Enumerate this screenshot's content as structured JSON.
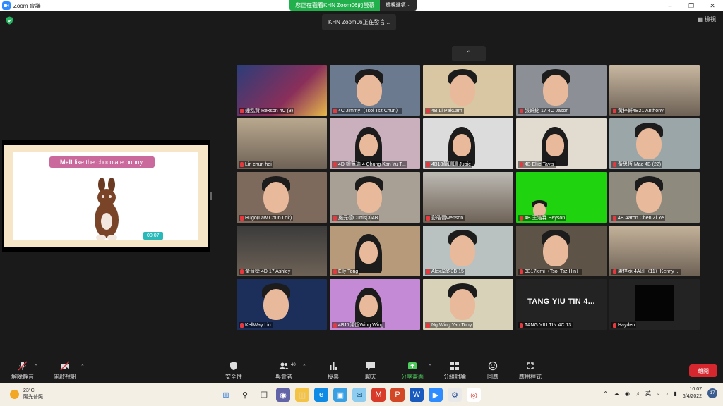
{
  "window": {
    "title": "Zoom 會議"
  },
  "share_banner": {
    "status": "您正在觀看KHN Zoom06的螢幕",
    "view_options": "檢視選項 ⌄"
  },
  "speaker_view": "檢視",
  "speaking_indicator": "KHN Zoom06正在發言...",
  "shared_slide": {
    "caption_bold": "Melt",
    "caption_rest": " like the chocolate bunny.",
    "timer": "00:07"
  },
  "participants": [
    {
      "name": "鍾泓賢 Rexson 4C (3)",
      "bg": "#2a3d7a",
      "kind": "anime"
    },
    {
      "name": "4C Jimmy（Tsoi Tsz Chun）",
      "bg": "#6b7a8e",
      "kind": "boy"
    },
    {
      "name": "4B Li PakLam",
      "bg": "#d9c6a3",
      "kind": "boy"
    },
    {
      "name": "張軒銘 17 4C Jason",
      "bg": "#8c8f96",
      "kind": "boy"
    },
    {
      "name": "黃梓軒4B21 Anthony",
      "bg": "#c9b8a1",
      "kind": "room"
    },
    {
      "name": "Lin chun hei",
      "bg": "#b9a88f",
      "kind": "room"
    },
    {
      "name": "4D 鍾蓮瑜 4 Chung Kan Yu T...",
      "bg": "#c9b0bc",
      "kind": "girl"
    },
    {
      "name": "4B18黃珊珊 Jubie",
      "bg": "#dcdcdc",
      "kind": "girl"
    },
    {
      "name": "4B Ellie Tavis",
      "bg": "#e2dcd0",
      "kind": "girl"
    },
    {
      "name": "黃思恆 Mac 4B (22)",
      "bg": "#9aa6a8",
      "kind": "boy"
    },
    {
      "name": "Hugo(Law Chun Lok)",
      "bg": "#7d6a5c",
      "kind": "boy"
    },
    {
      "name": "施元德Curtis(3)4B",
      "bg": "#a8a094",
      "kind": "boy"
    },
    {
      "name": "彭皓晉wenson",
      "bg": "#bdbab4",
      "kind": "room"
    },
    {
      "name": "4B 王浩霖 Heyson",
      "bg": "#1fd30f",
      "kind": "green"
    },
    {
      "name": "4B Aaron Chen Zi Ye",
      "bg": "#8e8a7e",
      "kind": "boy"
    },
    {
      "name": "黃晉婕 4D 17 Ashley",
      "bg": "#3b3b3b",
      "kind": "room"
    },
    {
      "name": "Elly Tong",
      "bg": "#b69a7a",
      "kind": "girl"
    },
    {
      "name": "Alex莫鈞3B 15",
      "bg": "#b9c2c1",
      "kind": "boy"
    },
    {
      "name": "3B17kimi（Tsoi Tsz Hin）",
      "bg": "#5e5347",
      "kind": "boy"
    },
    {
      "name": "盧梓丞 4A班（11）Kenny ...",
      "bg": "#c4b29a",
      "kind": "room"
    },
    {
      "name": "KellWay Lin",
      "bg": "#1b2f5a",
      "kind": "boy"
    },
    {
      "name": "4B17潘恆Wing Wing",
      "bg": "#c48ad6",
      "kind": "girl"
    },
    {
      "name": "Ng Wing Yan Toby",
      "bg": "#d8d2b8",
      "kind": "boy"
    },
    {
      "name": "TANG YIU TIN 4C 13",
      "bg": "#232323",
      "kind": "text",
      "display": "TANG YIU TIN 4..."
    },
    {
      "name": "Hayden",
      "bg": "#232323",
      "kind": "dark"
    }
  ],
  "toolbar": {
    "unmute": "解除靜音",
    "start_video": "開啟視訊",
    "security": "安全性",
    "participants": "與會者",
    "participants_count": "40",
    "polls": "投票",
    "chat": "聊天",
    "share_screen": "分享畫面",
    "breakout": "分組討論",
    "reactions": "回應",
    "apps": "應用程式",
    "end": "離開"
  },
  "taskbar": {
    "temp": "23°C",
    "weather": "陽光普照",
    "lang": "英",
    "time": "10:07",
    "date": "6/4/2022",
    "notifications": "17"
  },
  "colors": {
    "share_green": "#21b04b",
    "end_red": "#d6262e",
    "zoom_blue": "#2d8cff"
  }
}
